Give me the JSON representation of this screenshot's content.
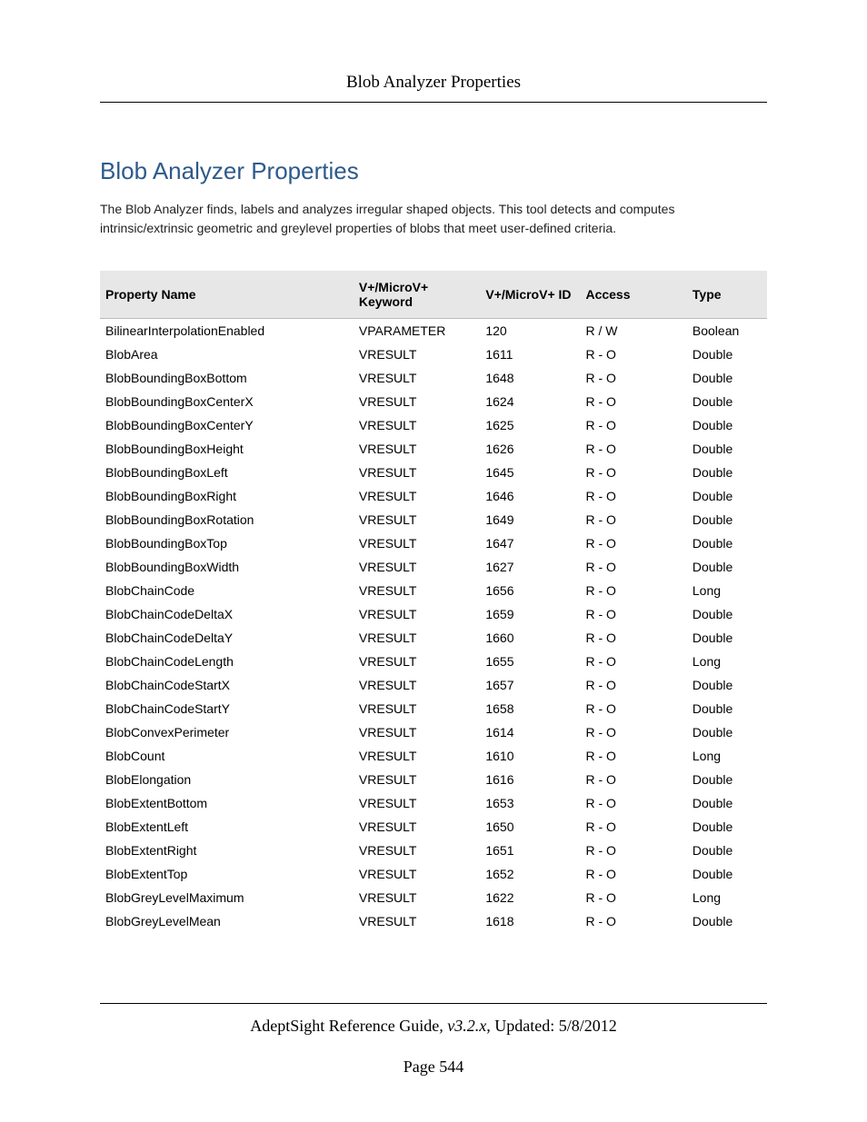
{
  "header": {
    "running_title": "Blob Analyzer Properties"
  },
  "content": {
    "title": "Blob Analyzer Properties",
    "intro": "The Blob Analyzer finds, labels and analyzes irregular shaped objects. This tool detects and computes intrinsic/extrinsic geometric and greylevel properties of blobs that meet user-defined criteria."
  },
  "table": {
    "headers": {
      "name": "Property Name",
      "keyword": "V+/MicroV+ Keyword",
      "id": "V+/MicroV+ ID",
      "access": "Access",
      "type": "Type"
    },
    "rows": [
      {
        "name": "BilinearInterpolationEnabled",
        "keyword": "VPARAMETER",
        "id": "120",
        "access": "R / W",
        "type": "Boolean"
      },
      {
        "name": "BlobArea",
        "keyword": "VRESULT",
        "id": "1611",
        "access": "R - O",
        "type": "Double"
      },
      {
        "name": "BlobBoundingBoxBottom",
        "keyword": "VRESULT",
        "id": "1648",
        "access": "R - O",
        "type": "Double"
      },
      {
        "name": "BlobBoundingBoxCenterX",
        "keyword": "VRESULT",
        "id": "1624",
        "access": "R - O",
        "type": "Double"
      },
      {
        "name": "BlobBoundingBoxCenterY",
        "keyword": "VRESULT",
        "id": "1625",
        "access": "R - O",
        "type": "Double"
      },
      {
        "name": "BlobBoundingBoxHeight",
        "keyword": "VRESULT",
        "id": "1626",
        "access": "R - O",
        "type": "Double"
      },
      {
        "name": "BlobBoundingBoxLeft",
        "keyword": "VRESULT",
        "id": "1645",
        "access": "R - O",
        "type": "Double"
      },
      {
        "name": "BlobBoundingBoxRight",
        "keyword": "VRESULT",
        "id": "1646",
        "access": "R - O",
        "type": "Double"
      },
      {
        "name": "BlobBoundingBoxRotation",
        "keyword": "VRESULT",
        "id": "1649",
        "access": "R - O",
        "type": "Double"
      },
      {
        "name": "BlobBoundingBoxTop",
        "keyword": "VRESULT",
        "id": "1647",
        "access": "R - O",
        "type": "Double"
      },
      {
        "name": "BlobBoundingBoxWidth",
        "keyword": "VRESULT",
        "id": "1627",
        "access": "R - O",
        "type": "Double"
      },
      {
        "name": "BlobChainCode",
        "keyword": "VRESULT",
        "id": "1656",
        "access": "R - O",
        "type": "Long"
      },
      {
        "name": "BlobChainCodeDeltaX",
        "keyword": "VRESULT",
        "id": "1659",
        "access": "R - O",
        "type": "Double"
      },
      {
        "name": "BlobChainCodeDeltaY",
        "keyword": "VRESULT",
        "id": "1660",
        "access": "R - O",
        "type": "Double"
      },
      {
        "name": "BlobChainCodeLength",
        "keyword": "VRESULT",
        "id": "1655",
        "access": "R - O",
        "type": "Long"
      },
      {
        "name": "BlobChainCodeStartX",
        "keyword": "VRESULT",
        "id": "1657",
        "access": "R - O",
        "type": "Double"
      },
      {
        "name": "BlobChainCodeStartY",
        "keyword": "VRESULT",
        "id": "1658",
        "access": "R - O",
        "type": "Double"
      },
      {
        "name": "BlobConvexPerimeter",
        "keyword": "VRESULT",
        "id": "1614",
        "access": "R - O",
        "type": "Double"
      },
      {
        "name": "BlobCount",
        "keyword": "VRESULT",
        "id": "1610",
        "access": "R - O",
        "type": "Long"
      },
      {
        "name": "BlobElongation",
        "keyword": "VRESULT",
        "id": "1616",
        "access": "R - O",
        "type": "Double"
      },
      {
        "name": "BlobExtentBottom",
        "keyword": "VRESULT",
        "id": "1653",
        "access": "R - O",
        "type": "Double"
      },
      {
        "name": "BlobExtentLeft",
        "keyword": "VRESULT",
        "id": "1650",
        "access": "R - O",
        "type": "Double"
      },
      {
        "name": "BlobExtentRight",
        "keyword": "VRESULT",
        "id": "1651",
        "access": "R - O",
        "type": "Double"
      },
      {
        "name": "BlobExtentTop",
        "keyword": "VRESULT",
        "id": "1652",
        "access": "R - O",
        "type": "Double"
      },
      {
        "name": "BlobGreyLevelMaximum",
        "keyword": "VRESULT",
        "id": "1622",
        "access": "R - O",
        "type": "Long"
      },
      {
        "name": "BlobGreyLevelMean",
        "keyword": "VRESULT",
        "id": "1618",
        "access": "R - O",
        "type": "Double"
      }
    ]
  },
  "footer": {
    "guide": "AdeptSight Reference Guide",
    "version": ", v3.2.x",
    "updated": ", Updated: 5/8/2012",
    "page_label": "Page 544"
  }
}
